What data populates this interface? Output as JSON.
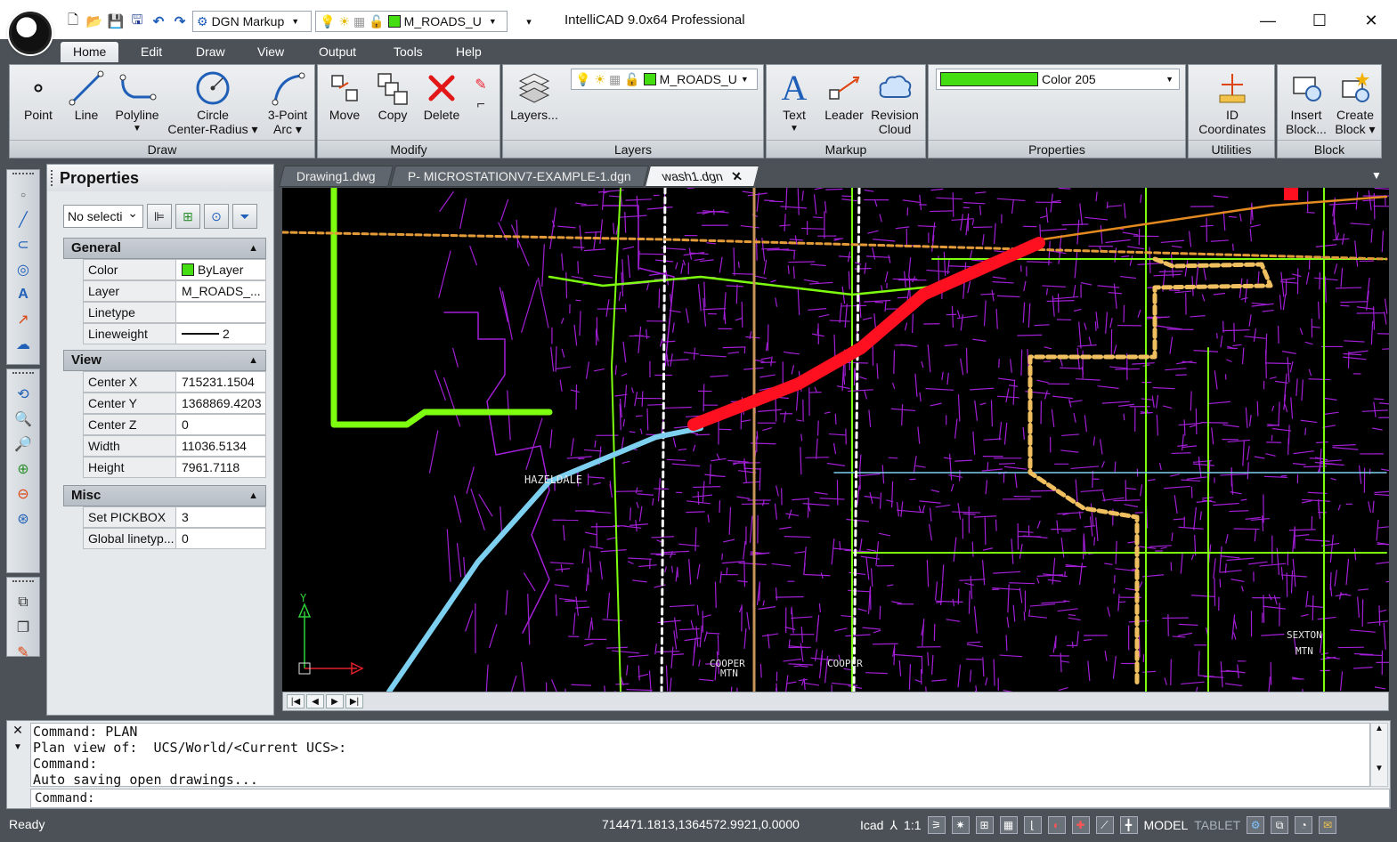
{
  "window": {
    "title": "IntelliCAD 9.0x64 Professional",
    "workspace": "DGN Markup",
    "layer_combo": "M_ROADS_U",
    "controls": {
      "minimize": "—",
      "maximize": "☐",
      "close": "✕"
    }
  },
  "ribbon_tabs": [
    "Home",
    "Edit",
    "Draw",
    "View",
    "Output",
    "Tools",
    "Help"
  ],
  "ribbon": {
    "draw": {
      "title": "Draw",
      "point": "Point",
      "line": "Line",
      "polyline": "Polyline",
      "circle_1": "Circle",
      "circle_2": "Center-Radius ▾",
      "arc_1": "3-Point",
      "arc_2": "Arc ▾"
    },
    "modify": {
      "title": "Modify",
      "move": "Move",
      "copy": "Copy",
      "delete": "Delete"
    },
    "layers": {
      "title": "Layers",
      "button": "Layers...",
      "current_layer": "M_ROADS_U"
    },
    "markup": {
      "title": "Markup",
      "text": "Text",
      "leader": "Leader",
      "revision_1": "Revision",
      "revision_2": "Cloud"
    },
    "properties": {
      "title": "Properties",
      "color": "Color 205",
      "color_hex": "#44dd11"
    },
    "utilities": {
      "title": "Utilities",
      "id_1": "ID",
      "id_2": "Coordinates"
    },
    "block": {
      "title": "Block",
      "insert_1": "Insert",
      "insert_2": "Block...",
      "create_1": "Create",
      "create_2": "Block ▾"
    }
  },
  "properties_panel": {
    "title": "Properties",
    "selection": "No selecti",
    "general": {
      "title": "General",
      "rows": [
        {
          "key": "Color",
          "value": "ByLayer"
        },
        {
          "key": "Layer",
          "value": "M_ROADS_..."
        },
        {
          "key": "Linetype",
          "value": ""
        },
        {
          "key": "Lineweight",
          "value": "2"
        }
      ]
    },
    "view": {
      "title": "View",
      "rows": [
        {
          "key": "Center X",
          "value": "715231.1504"
        },
        {
          "key": "Center Y",
          "value": "1368869.4203"
        },
        {
          "key": "Center Z",
          "value": "0"
        },
        {
          "key": "Width",
          "value": "11036.5134"
        },
        {
          "key": "Height",
          "value": "7961.7118"
        }
      ]
    },
    "misc": {
      "title": "Misc",
      "rows": [
        {
          "key": "Set PICKBOX",
          "value": "3"
        },
        {
          "key": "Global linetyp...",
          "value": "0"
        }
      ]
    }
  },
  "doc_tabs": [
    {
      "label": "Drawing1.dwg",
      "active": false
    },
    {
      "label": "P- MICROSTATIONV7-EXAMPLE-1.dgn",
      "active": false
    },
    {
      "label": "wash1.dgn",
      "active": true
    }
  ],
  "drawing": {
    "labels": [
      "HAZELDALE",
      "COOPER",
      "MTN",
      "COOPER",
      "SEXTON",
      "MTN"
    ],
    "ucs_y": "Y",
    "colors": {
      "roads": "#a21fd6",
      "highlight": "#ff1020",
      "green": "#7fff10",
      "cyan": "#7ed0f0",
      "orange": "#e39b3a"
    }
  },
  "command": {
    "history": [
      "Command: PLAN",
      "Plan view of:  UCS/World/<Current UCS>:",
      "Command:",
      "Auto saving open drawings..."
    ],
    "prompt": "Command:"
  },
  "status": {
    "state": "Ready",
    "coordinates": "714471.1813,1364572.9921,0.0000",
    "icad": "Icad",
    "scale": "1:1",
    "model": "MODEL",
    "tablet": "TABLET"
  }
}
